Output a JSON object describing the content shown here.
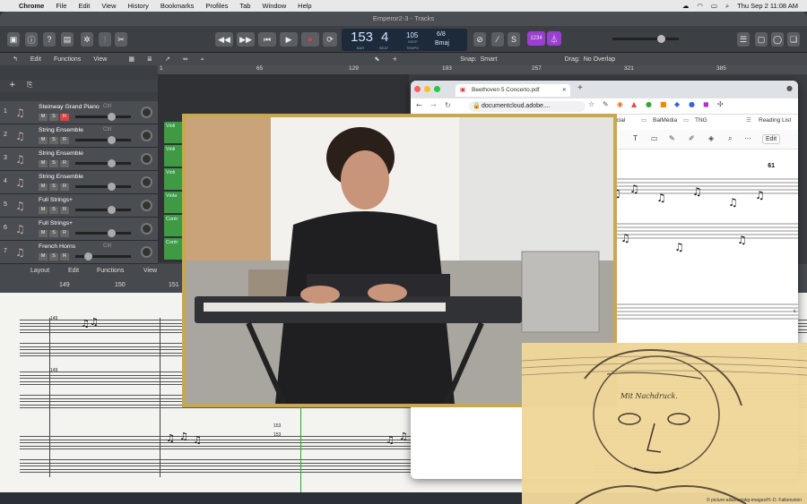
{
  "menubar": {
    "apple": "",
    "app": "Chrome",
    "items": [
      "File",
      "Edit",
      "View",
      "History",
      "Bookmarks",
      "Profiles",
      "Tab",
      "Window",
      "Help"
    ],
    "datetime": "Thu Sep 2  11:08 AM"
  },
  "logic": {
    "window_title": "Emperor2-3 - Tracks",
    "lcd": {
      "bar": "153",
      "beat": "4",
      "bar_label": "BAR",
      "beat_label": "BEAT",
      "tempo": "105",
      "tempo_label": "TEMPO",
      "keep": "KEEP",
      "sig": "6/8",
      "key": "Bmaj"
    },
    "badge": "1234",
    "toolbar": {
      "edit": "Edit",
      "functions": "Functions",
      "view": "View",
      "snap_label": "Snap:",
      "snap_value": "Smart",
      "drag_label": "Drag:",
      "drag_value": "No Overlap"
    },
    "ruler": [
      "1",
      "65",
      "129",
      "193",
      "257",
      "321",
      "385"
    ],
    "tracks": [
      {
        "num": "1",
        "name": "Steinway Grand Piano",
        "ch": "Ctrl"
      },
      {
        "num": "2",
        "name": "String Ensemble",
        "ch": "Ctrl"
      },
      {
        "num": "3",
        "name": "String Ensemble",
        "ch": ""
      },
      {
        "num": "4",
        "name": "String Ensemble",
        "ch": ""
      },
      {
        "num": "5",
        "name": "Full Strings+",
        "ch": ""
      },
      {
        "num": "6",
        "name": "Full Strings+",
        "ch": ""
      },
      {
        "num": "7",
        "name": "French Horns",
        "ch": "Ctrl"
      }
    ],
    "msr": {
      "m": "M",
      "s": "S",
      "r": "R"
    },
    "region_labels": [
      "Violi",
      "Violi",
      "Violi",
      "Viola",
      "Contr",
      "Contr"
    ],
    "score_toolbar": {
      "layout": "Layout",
      "edit": "Edit",
      "functions": "Functions",
      "view": "View"
    },
    "score_ruler": [
      "149",
      "150",
      "151"
    ],
    "score_bars": [
      "149",
      "149",
      "153",
      "153"
    ]
  },
  "chrome": {
    "tab_title": "Beethoven 5 Concerto.pdf",
    "new_tab": "+",
    "url": "documentcloud.adobe....",
    "bookmarks": [
      "ocial",
      "BalMédia",
      "TNG"
    ],
    "reading_list": "Reading List",
    "pdf_edit": "Edit",
    "page_num": "61",
    "pdf_text": "Mit Nachdruck."
  },
  "beethoven_credit": "© picture-alliance/akg-images/H.-D. Falkenstein",
  "colors": {
    "accent_purple": "#9a3fd1",
    "region_green": "#3f9a43",
    "frame_gold": "#c9a84c",
    "record_red": "#e04040"
  }
}
